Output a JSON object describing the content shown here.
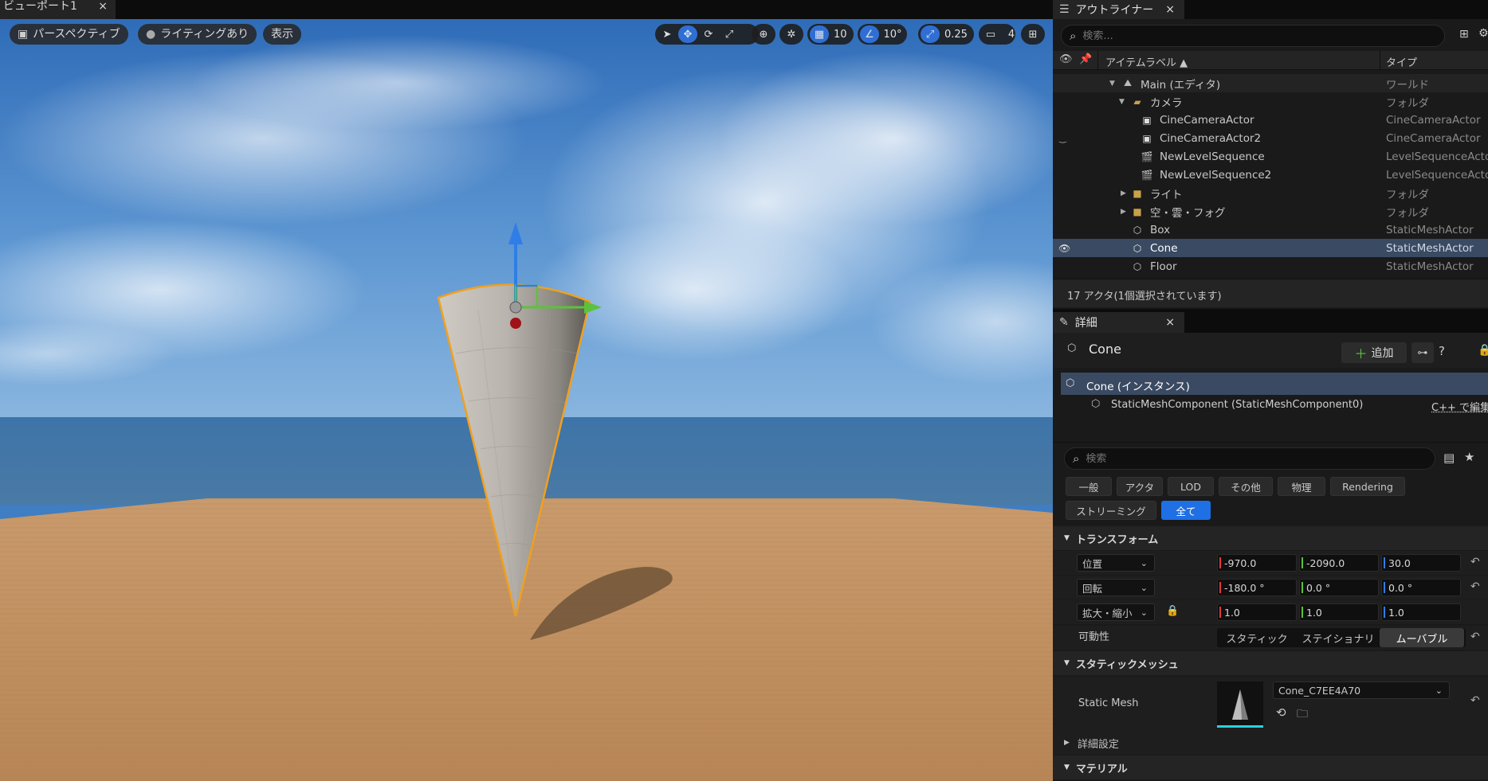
{
  "viewport": {
    "tab_label": "ビューポート1",
    "close": "×",
    "perspective_label": "パースペクティブ",
    "lighting_label": "ライティングあり",
    "show_label": "表示",
    "grid_value": "10",
    "angle_value": "10°",
    "scale_value": "0.25",
    "camera_speed": "4"
  },
  "outliner": {
    "tab_label": "アウトライナー",
    "close": "×",
    "search_placeholder": "検索...",
    "col_label": "アイテムラベル ▲",
    "col_type": "タイプ",
    "rows": [
      {
        "label": "Main (エディタ)",
        "type": "ワールド",
        "icon": "world-icon"
      },
      {
        "label": "カメラ",
        "type": "フォルダ",
        "icon": "folder-open-icon"
      },
      {
        "label": "CineCameraActor",
        "type": "CineCameraActor",
        "icon": "camera-icon"
      },
      {
        "label": "CineCameraActor2",
        "type": "CineCameraActor",
        "icon": "camera-icon"
      },
      {
        "label": "NewLevelSequence",
        "type": "LevelSequenceActor",
        "icon": "clapper-icon"
      },
      {
        "label": "NewLevelSequence2",
        "type": "LevelSequenceActor",
        "icon": "clapper-icon"
      },
      {
        "label": "ライト",
        "type": "フォルダ",
        "icon": "folder-icon"
      },
      {
        "label": "空・雲・フォグ",
        "type": "フォルダ",
        "icon": "folder-icon"
      },
      {
        "label": "Box",
        "type": "StaticMeshActor",
        "icon": "static-mesh-icon"
      },
      {
        "label": "Cone",
        "type": "StaticMeshActor",
        "icon": "static-mesh-icon"
      },
      {
        "label": "Floor",
        "type": "StaticMeshActor",
        "icon": "static-mesh-icon"
      }
    ],
    "status": "17 アクタ(1個選択されています)"
  },
  "details": {
    "tab_label": "詳細",
    "close": "×",
    "actor_name": "Cone",
    "add_label": "追加",
    "instance_label": "Cone (インスタンス)",
    "component_label": "StaticMeshComponent (StaticMeshComponent0)",
    "cpp_edit": "C++ で編集",
    "search_placeholder": "検索",
    "filters_row1": [
      "一般",
      "アクタ",
      "LOD",
      "その他",
      "物理",
      "Rendering"
    ],
    "filters_row2": [
      "ストリーミング",
      "全て"
    ],
    "active_filter": "全て",
    "transform": {
      "section": "トランスフォーム",
      "location_label": "位置",
      "location": [
        "-970.0",
        "-2090.0",
        "30.0"
      ],
      "rotation_label": "回転",
      "rotation": [
        "-180.0 °",
        "0.0 °",
        "0.0 °"
      ],
      "scale_label": "拡大・縮小",
      "scale": [
        "1.0",
        "1.0",
        "1.0"
      ],
      "mobility_label": "可動性",
      "mobility_options": [
        "スタティック",
        "ステイショナリ",
        "ムーバブル"
      ],
      "mobility_selected": "ムーバブル"
    },
    "static_mesh": {
      "section": "スタティックメッシュ",
      "label": "Static Mesh",
      "value": "Cone_C7EE4A70"
    },
    "advanced_label": "詳細設定",
    "material_section": "マテリアル"
  },
  "colors": {
    "x_axis": "#e23a3a",
    "y_axis": "#5cc23a",
    "z_axis": "#2f7ee6",
    "accent": "#1f6fe5",
    "selection_outline": "#f0a020"
  }
}
